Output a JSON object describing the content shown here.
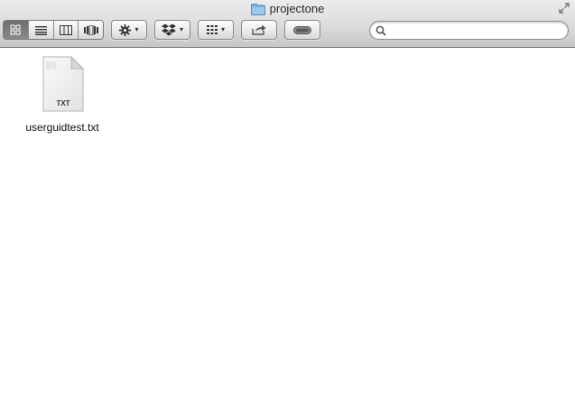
{
  "window": {
    "title": "projectone"
  },
  "toolbar": {
    "view_buttons": [
      {
        "name": "icon-view",
        "active": true
      },
      {
        "name": "list-view",
        "active": false
      },
      {
        "name": "column-view",
        "active": false
      },
      {
        "name": "cover-flow-view",
        "active": false
      }
    ],
    "action_icon": "gear-icon",
    "dropbox_icon": "dropbox-icon",
    "arrange_icon": "arrange-grid-icon",
    "share_icon": "share-icon",
    "tags_icon": "toggle-icon",
    "dropdown_caret": "▾"
  },
  "search": {
    "value": "",
    "placeholder": ""
  },
  "files": [
    {
      "name": "userguidtest.txt",
      "icon_label": "TXT"
    }
  ]
}
